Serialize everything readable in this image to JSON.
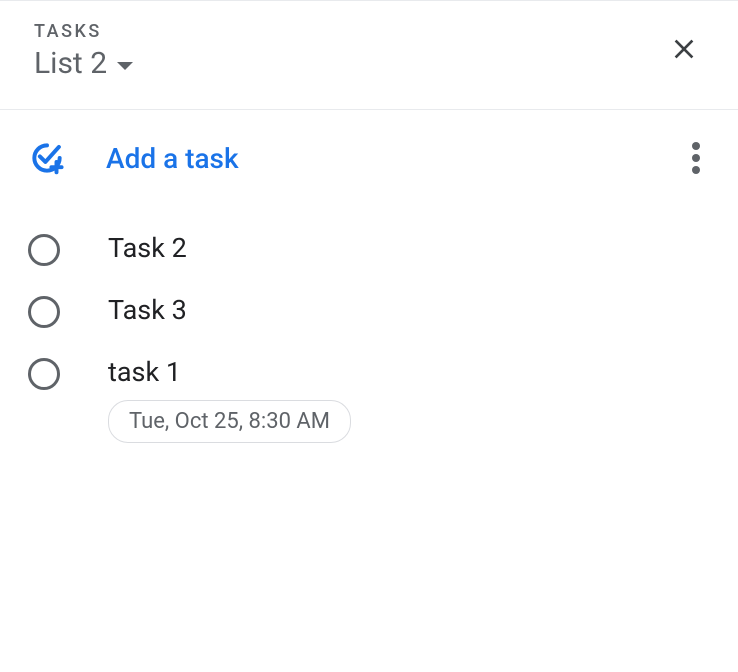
{
  "header": {
    "label": "TASKS",
    "list_name": "List 2"
  },
  "add_task": {
    "label": "Add a task"
  },
  "tasks": [
    {
      "title": "Task 2",
      "datetime": null
    },
    {
      "title": "Task 3",
      "datetime": null
    },
    {
      "title": "task 1",
      "datetime": "Tue, Oct 25, 8:30 AM"
    }
  ]
}
